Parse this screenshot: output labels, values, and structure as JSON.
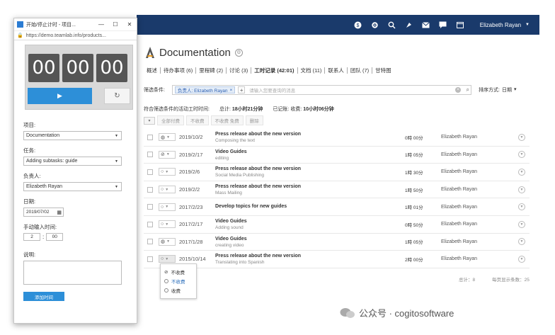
{
  "topbar": {
    "icons": [
      "dollar-icon",
      "gear-icon",
      "search-icon",
      "bolt-icon",
      "mail-icon",
      "chat-icon",
      "calendar-icon"
    ],
    "user": "Elizabeth Rayan"
  },
  "page": {
    "title": "Documentation",
    "tabs": [
      {
        "label": "概述"
      },
      {
        "label": "待办事项 (6)"
      },
      {
        "label": "里程碑 (2)"
      },
      {
        "label": "讨论 (3)"
      },
      {
        "label": "工时记录 (42:01)"
      },
      {
        "label": "文档 (11)"
      },
      {
        "label": "联系人"
      },
      {
        "label": "团队 (7)"
      },
      {
        "label": "甘特图"
      }
    ],
    "filter": {
      "label": "筛选条件:",
      "chip": "负责人: Elizabeth Rayan",
      "placeholder": "请输入您要查询的消息",
      "sort_label": "排序方式:",
      "sort_value": "日期"
    },
    "summary": {
      "label": "符合筛选条件的活动工时时间:",
      "total_label": "总计:",
      "total_value": "18小时21分钟",
      "billed_label": "已记账: 收费:",
      "billed_value": "10小时06分钟"
    },
    "actions": [
      "全部付费",
      "不收费",
      "不收费 免费",
      "删除"
    ],
    "rows": [
      {
        "date": "2019/10/2",
        "title": "Press release about the new version",
        "sub": "Composing the text",
        "duration": "0時 00分",
        "person": "Elizabeth Rayan"
      },
      {
        "date": "2019/2/17",
        "title": "Video Guides",
        "sub": "editing",
        "duration": "1時 05分",
        "person": "Elizabeth Rayan"
      },
      {
        "date": "2019/2/6",
        "title": "Press release about the new version",
        "sub": "Social Media Publishing",
        "duration": "1時 30分",
        "person": "Elizabeth Rayan"
      },
      {
        "date": "2019/2/2",
        "title": "Press release about the new version",
        "sub": "Mass Mailing",
        "duration": "1時 50分",
        "person": "Elizabeth Rayan"
      },
      {
        "date": "2017/2/23",
        "title": "Develop topics for new guides",
        "sub": "",
        "duration": "1時 01分",
        "person": "Elizabeth Rayan"
      },
      {
        "date": "2017/2/17",
        "title": "Video Guides",
        "sub": "Adding sound",
        "duration": "0時 50分",
        "person": "Elizabeth Rayan"
      },
      {
        "date": "2017/1/28",
        "title": "Video Guides",
        "sub": "creating video",
        "duration": "1時 05分",
        "person": "Elizabeth Rayan"
      },
      {
        "date": "2015/10/14",
        "title": "Press release about the new version",
        "sub": "Translating into Spanish",
        "duration": "2時 00分",
        "person": "Elizabeth Rayan"
      }
    ],
    "dropdown": [
      "不收费",
      "不收费",
      "收费"
    ],
    "pager": {
      "total": "总计：8",
      "per_page": "每页显示条数：25"
    }
  },
  "timer_window": {
    "title": "开始/停止计时 - 项目...",
    "url": "https://demo.teamlab.info/products...",
    "hours": "00",
    "minutes": "00",
    "seconds": "00",
    "project_label": "项目:",
    "project_value": "Documentation",
    "task_label": "任务:",
    "task_value": "Adding subtasks: guide",
    "owner_label": "负责人:",
    "owner_value": "Elizabeth Rayan",
    "date_label": "日期:",
    "date_value": "2019/07/02",
    "manual_label": "手动输入时间:",
    "manual_hours": "2",
    "manual_minutes": "00",
    "note_label": "说明:",
    "add_button": "添加时间"
  },
  "watermark": "公众号 · cogitosoftware",
  "colors": {
    "topbar": "#1a3a6b",
    "accent": "#2d8fd8"
  }
}
